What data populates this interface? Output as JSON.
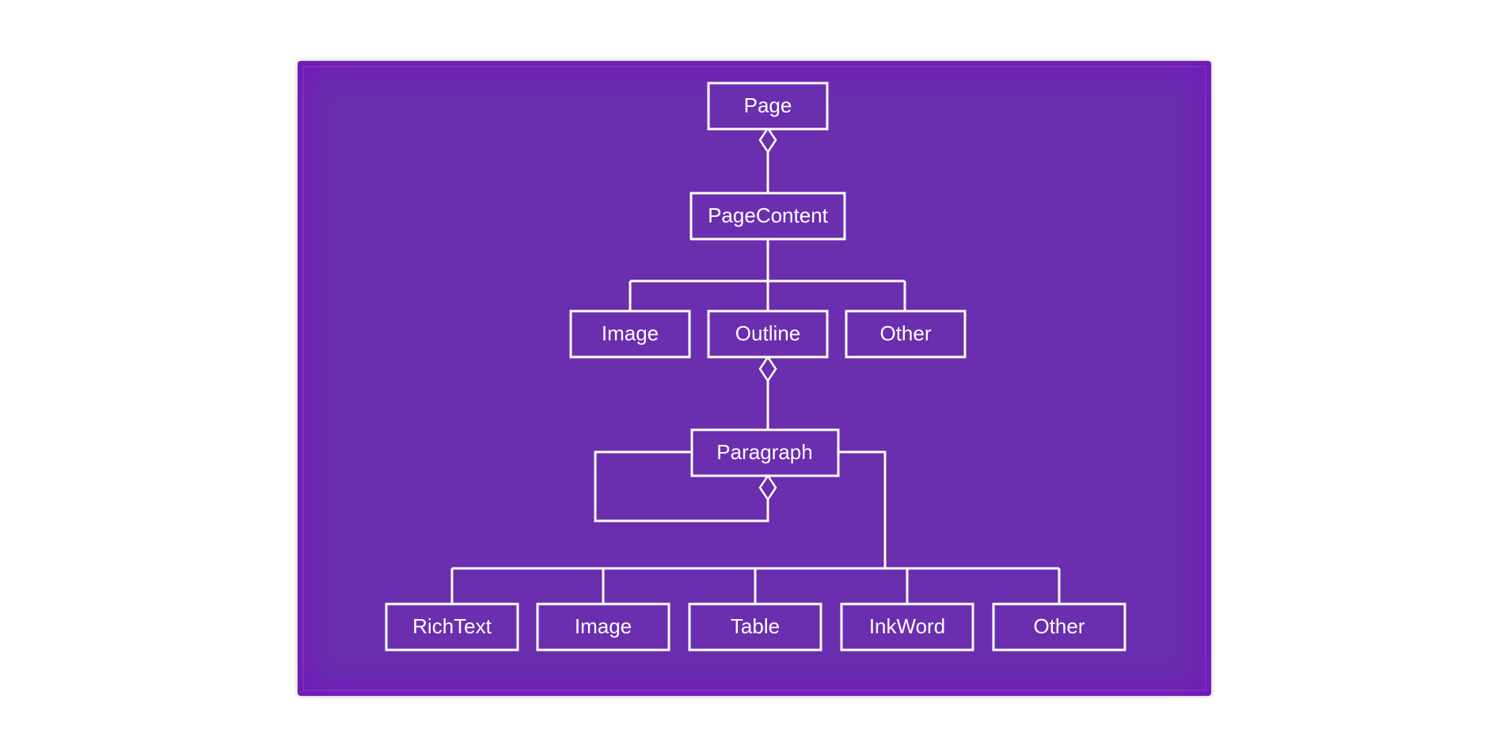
{
  "diagram": {
    "background": "#6a2eaf",
    "stroke": "#ffffff",
    "nodes": {
      "page": "Page",
      "pageContent": "PageContent",
      "image1": "Image",
      "outline": "Outline",
      "other1": "Other",
      "paragraph": "Paragraph",
      "richText": "RichText",
      "image2": "Image",
      "table": "Table",
      "inkWord": "InkWord",
      "other2": "Other"
    }
  },
  "chart_data": {
    "type": "tree-diagram",
    "description": "Hierarchical aggregation (diamond = aggregation) class diagram",
    "root": "Page",
    "edges": [
      {
        "from": "Page",
        "to": "PageContent",
        "relation": "aggregation"
      },
      {
        "from": "PageContent",
        "to": "Image",
        "relation": "child"
      },
      {
        "from": "PageContent",
        "to": "Outline",
        "relation": "child"
      },
      {
        "from": "PageContent",
        "to": "Other",
        "relation": "child"
      },
      {
        "from": "Outline",
        "to": "Paragraph",
        "relation": "aggregation"
      },
      {
        "from": "Paragraph",
        "to": "Paragraph",
        "relation": "aggregation-self-loop"
      },
      {
        "from": "Paragraph",
        "to": "RichText",
        "relation": "child"
      },
      {
        "from": "Paragraph",
        "to": "Image",
        "relation": "child"
      },
      {
        "from": "Paragraph",
        "to": "Table",
        "relation": "child"
      },
      {
        "from": "Paragraph",
        "to": "InkWord",
        "relation": "child"
      },
      {
        "from": "Paragraph",
        "to": "Other",
        "relation": "child"
      }
    ]
  }
}
